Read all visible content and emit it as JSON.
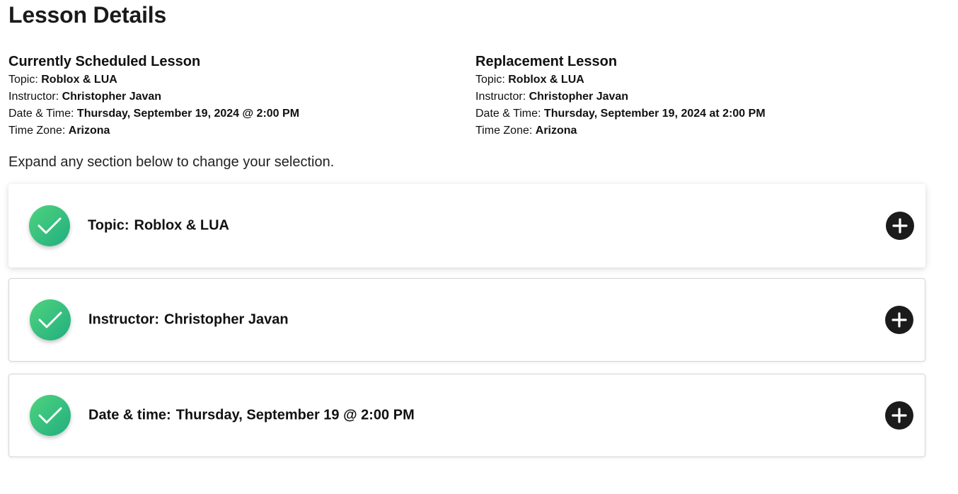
{
  "page": {
    "title": "Lesson Details"
  },
  "current_lesson": {
    "heading": "Currently Scheduled Lesson",
    "topic_label": "Topic:",
    "topic": "Roblox & LUA",
    "instructor_label": "Instructor:",
    "instructor": "Christopher Javan",
    "datetime_label": "Date & Time:",
    "datetime": "Thursday, September 19, 2024 @ 2:00 PM",
    "timezone_label": "Time Zone:",
    "timezone": "Arizona"
  },
  "replacement_lesson": {
    "heading": "Replacement Lesson",
    "topic_label": "Topic:",
    "topic": "Roblox & LUA",
    "instructor_label": "Instructor:",
    "instructor": "Christopher Javan",
    "datetime_label": "Date & Time:",
    "datetime": "Thursday, September 19, 2024 at 2:00 PM",
    "timezone_label": "Time Zone:",
    "timezone": "Arizona"
  },
  "instruction": "Expand any section below to change your selection.",
  "sections": [
    {
      "label": "Topic:",
      "value": "Roblox & LUA",
      "status_icon": "check-icon",
      "action_icon": "plus-icon"
    },
    {
      "label": "Instructor:",
      "value": "Christopher Javan",
      "status_icon": "check-icon",
      "action_icon": "plus-icon"
    },
    {
      "label": "Date & time:",
      "value": "Thursday, September 19 @ 2:00 PM",
      "status_icon": "check-icon",
      "action_icon": "plus-icon"
    }
  ],
  "colors": {
    "check_gradient_start": "#4fd37e",
    "check_gradient_end": "#21ae80",
    "plus_button": "#1b1b1b",
    "text": "#111111"
  }
}
